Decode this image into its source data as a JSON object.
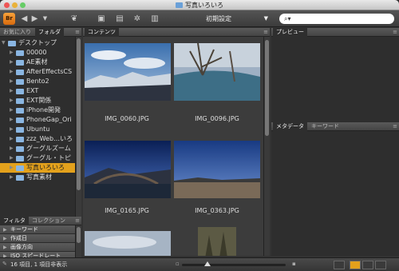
{
  "window": {
    "title": "写真いろいろ"
  },
  "toolbar": {
    "app_badge": "Br",
    "preset": "初期設定",
    "search_placeholder": "⌕▾"
  },
  "left": {
    "tabs": [
      "お気に入り",
      "フォルダ"
    ],
    "tree": [
      {
        "label": "デスクトップ",
        "indent": 0,
        "expanded": true,
        "color": "blue"
      },
      {
        "label": "00000",
        "indent": 1,
        "color": "blue"
      },
      {
        "label": "AE素材",
        "indent": 1,
        "color": "blue"
      },
      {
        "label": "AfterEffectsCS",
        "indent": 1,
        "color": "blue"
      },
      {
        "label": "Bento2",
        "indent": 1,
        "color": "blue"
      },
      {
        "label": "EXT",
        "indent": 1,
        "color": "blue"
      },
      {
        "label": "EXT関係",
        "indent": 1,
        "color": "blue"
      },
      {
        "label": "iPhone開発",
        "indent": 1,
        "color": "blue"
      },
      {
        "label": "PhoneGap_Ori",
        "indent": 1,
        "color": "blue"
      },
      {
        "label": "Ubuntu",
        "indent": 1,
        "color": "blue"
      },
      {
        "label": "zzz_Web…いろ",
        "indent": 1,
        "color": "blue"
      },
      {
        "label": "グーグルズーム",
        "indent": 1,
        "color": "blue"
      },
      {
        "label": "グーグル・トピ",
        "indent": 1,
        "color": "blue"
      },
      {
        "label": "写真いろいろ",
        "indent": 1,
        "color": "blue",
        "selected": true
      },
      {
        "label": "写真素材",
        "indent": 1,
        "color": "blue"
      }
    ],
    "filter_tabs": [
      "フィルタ",
      "コレクション"
    ],
    "filters": [
      "キーワード",
      "作成日",
      "画像方向",
      "ISO スピードレート",
      "露出時間"
    ]
  },
  "content": {
    "tab": "コンテンツ",
    "items": [
      {
        "name": "IMG_0060.JPG"
      },
      {
        "name": "IMG_0096.JPG"
      },
      {
        "name": "IMG_0165.JPG"
      },
      {
        "name": "IMG_0363.JPG"
      },
      {
        "name": ""
      },
      {
        "name": ""
      }
    ]
  },
  "right": {
    "preview_tab": "プレビュー",
    "meta_tabs": [
      "メタデータ",
      "キーワード"
    ]
  },
  "status": {
    "text": "16 項目, 1 項目非表示"
  },
  "colors": {
    "accent": "#e3a11c",
    "folder": "#8ab6e2"
  }
}
